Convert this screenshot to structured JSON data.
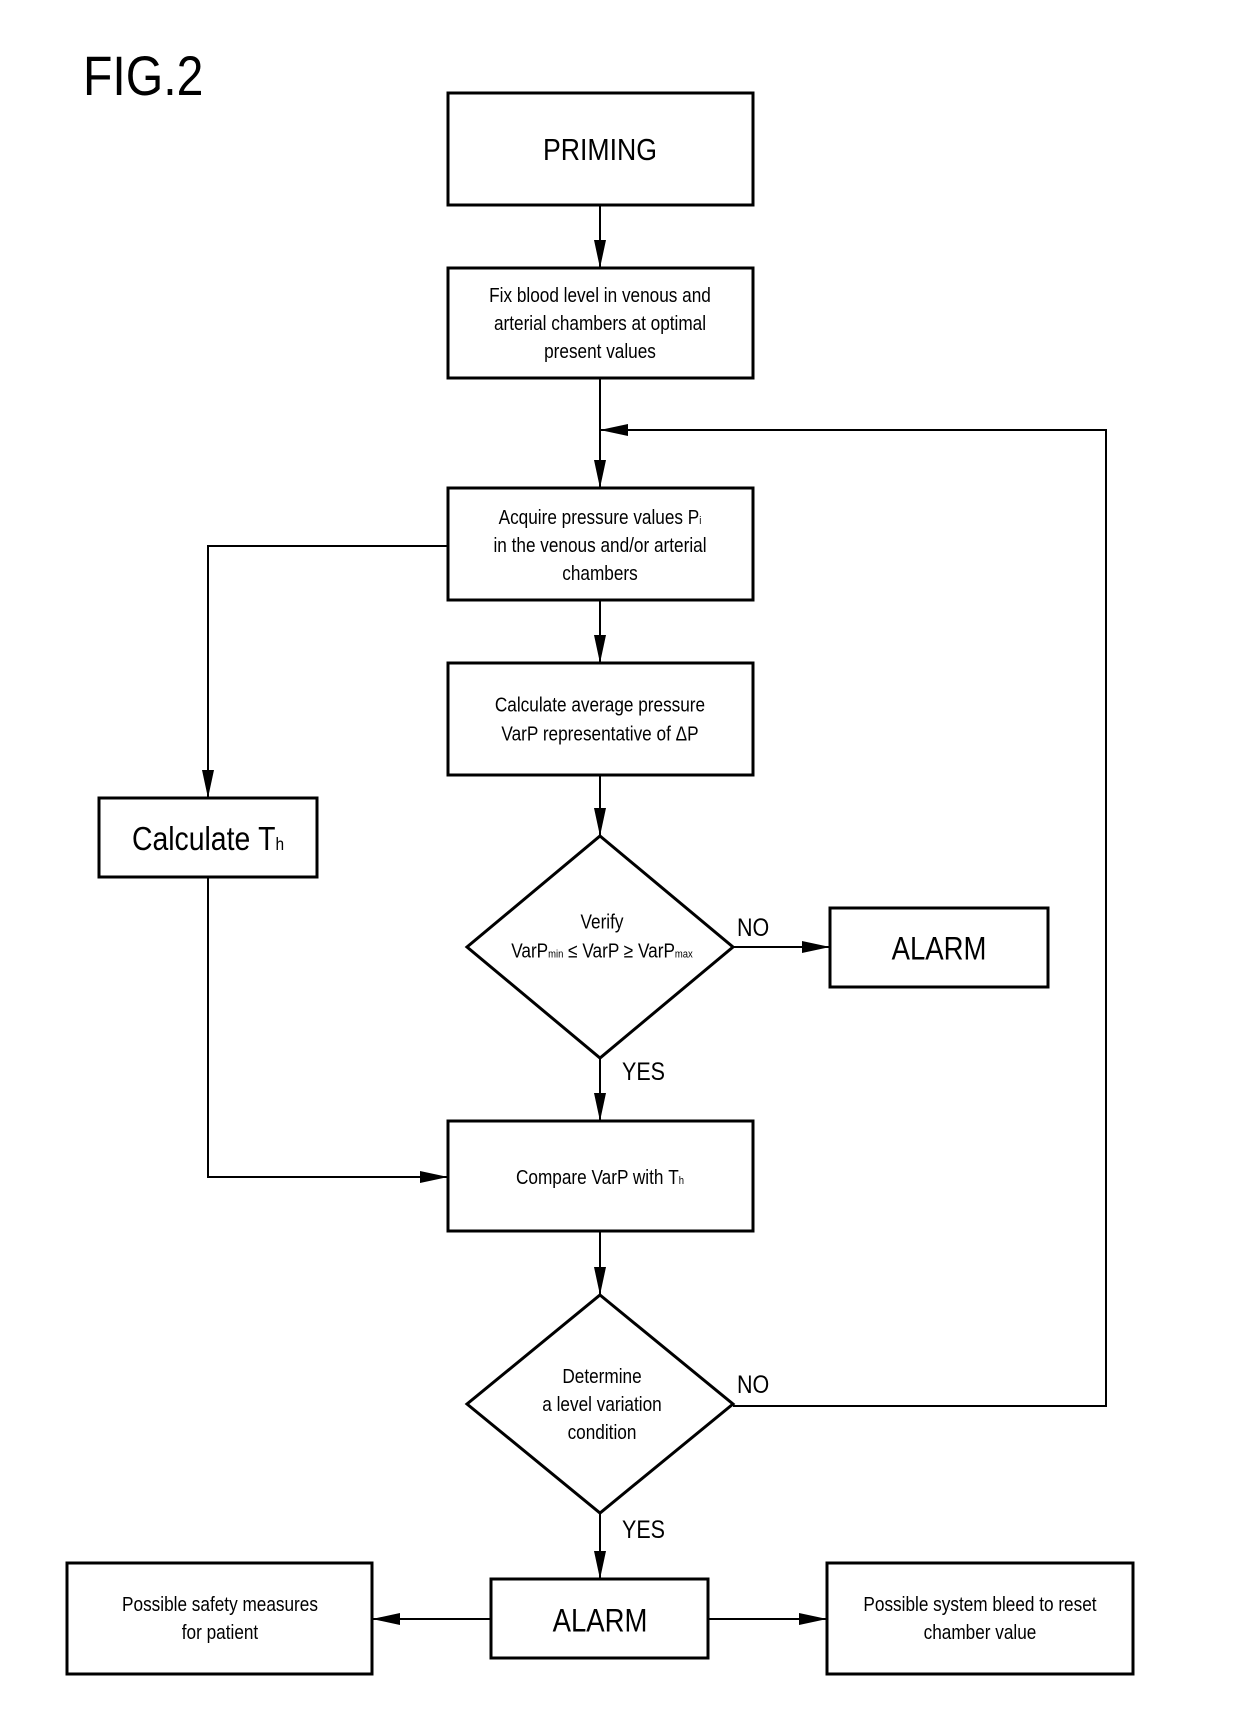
{
  "figure": {
    "title": "FIG.2"
  },
  "nodes": {
    "priming": {
      "lines": [
        "PRIMING"
      ]
    },
    "fix_level": {
      "lines": [
        "Fix blood level in venous and",
        "arterial chambers at optimal",
        "present values"
      ]
    },
    "acquire": {
      "lines": [
        "Acquire pressure values P|i",
        "in the venous and/or arterial",
        "chambers"
      ]
    },
    "calc_avg": {
      "lines": [
        "Calculate average pressure",
        "VarP representative of ΔP"
      ]
    },
    "calc_th": {
      "lines": [
        "Calculate T|h"
      ]
    },
    "verify": {
      "lines": [
        "Verify",
        "VarP|min ≤ VarP ≥ VarP|max"
      ]
    },
    "alarm_1": {
      "lines": [
        "ALARM"
      ]
    },
    "compare": {
      "lines": [
        "Compare VarP with T|h"
      ]
    },
    "determine": {
      "lines": [
        "Determine",
        "a level variation",
        "condition"
      ]
    },
    "alarm_2": {
      "lines": [
        "ALARM"
      ]
    },
    "safety": {
      "lines": [
        "Possible safety measures",
        "for patient"
      ]
    },
    "bleed": {
      "lines": [
        "Possible system bleed to reset",
        "chamber value"
      ]
    }
  },
  "edge_labels": {
    "verify_no": "NO",
    "verify_yes": "YES",
    "determine_no": "NO",
    "determine_yes": "YES"
  },
  "edges": [
    {
      "from": "priming",
      "to": "fix_level"
    },
    {
      "from": "fix_level",
      "to": "acquire"
    },
    {
      "from": "acquire",
      "to": "calc_avg"
    },
    {
      "from": "acquire",
      "to": "calc_th"
    },
    {
      "from": "calc_avg",
      "to": "verify"
    },
    {
      "from": "verify",
      "to": "alarm_1",
      "label": "NO"
    },
    {
      "from": "verify",
      "to": "compare",
      "label": "YES"
    },
    {
      "from": "calc_th",
      "to": "compare"
    },
    {
      "from": "compare",
      "to": "determine"
    },
    {
      "from": "determine",
      "to": "acquire",
      "label": "NO"
    },
    {
      "from": "determine",
      "to": "alarm_2",
      "label": "YES"
    },
    {
      "from": "alarm_2",
      "to": "safety"
    },
    {
      "from": "alarm_2",
      "to": "bleed"
    }
  ]
}
